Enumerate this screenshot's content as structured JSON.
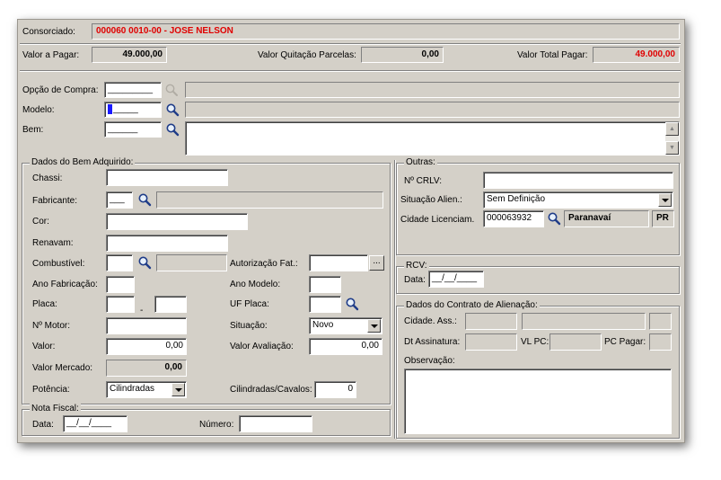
{
  "header": {
    "consorciado_label": "Consorciado:",
    "consorciado_value": "000060 0010-00 - JOSE NELSON",
    "valor_pagar_label": "Valor a Pagar:",
    "valor_pagar_value": "49.000,00",
    "valor_quitacao_label": "Valor Quitação Parcelas:",
    "valor_quitacao_value": "0,00",
    "valor_total_label": "Valor Total Pagar:",
    "valor_total_value": "49.000,00"
  },
  "selection": {
    "opcao_label": "Opção de Compra:",
    "opcao_value": "_________",
    "modelo_label": "Modelo:",
    "modelo_value": "_____",
    "bem_label": "Bem:",
    "bem_value": "______"
  },
  "dados_bem": {
    "title": "Dados do Bem Adquirido:",
    "chassi_label": "Chassi:",
    "fabricante_label": "Fabricante:",
    "fabricante_value": "___",
    "cor_label": "Cor:",
    "renavam_label": "Renavam:",
    "combustivel_label": "Combustível:",
    "autorizacao_label": "Autorização Fat.:",
    "autorizacao_btn": "...",
    "ano_fab_label": "Ano Fabricação:",
    "ano_modelo_label": "Ano Modelo:",
    "placa_label": "Placa:",
    "placa_sep": "-",
    "uf_placa_label": "UF Placa:",
    "motor_label": "Nº Motor:",
    "situacao_label": "Situação:",
    "situacao_value": "Novo",
    "valor_label": "Valor:",
    "valor_value": "0,00",
    "valor_aval_label": "Valor Avaliação:",
    "valor_aval_value": "0,00",
    "valor_mercado_label": "Valor Mercado:",
    "valor_mercado_value": "0,00",
    "potencia_label": "Potência:",
    "potencia_value": "Cilindradas",
    "cilindradas_label": "Cilindradas/Cavalos:",
    "cilindradas_value": "0"
  },
  "outras": {
    "title": "Outras:",
    "crlv_label": "Nº CRLV:",
    "situacao_alien_label": "Situação Alien.:",
    "situacao_alien_value": "Sem Definição",
    "cidade_label": "Cidade Licenciam.",
    "cidade_code": "000063932",
    "cidade_name": "Paranavaí",
    "cidade_uf": "PR"
  },
  "rcv": {
    "title": "RCV:",
    "data_label": "Data:",
    "data_value": "__/__/____"
  },
  "contrato": {
    "title": "Dados do Contrato de Alienação:",
    "cidade_ass_label": "Cidade. Ass.:",
    "dt_ass_label": "Dt Assinatura:",
    "vl_pc_label": "VL PC:",
    "pc_pagar_label": "PC Pagar:",
    "observacao_label": "Observação:"
  },
  "nota_fiscal": {
    "title": "Nota Fiscal:",
    "data_label": "Data:",
    "data_value": "__/__/____",
    "numero_label": "Número:"
  },
  "colors": {
    "accent_red": "#e00000",
    "window_bg": "#d4d0c8"
  },
  "icons": {
    "search": "magnifier-icon",
    "search_disabled": "magnifier-disabled-icon"
  }
}
